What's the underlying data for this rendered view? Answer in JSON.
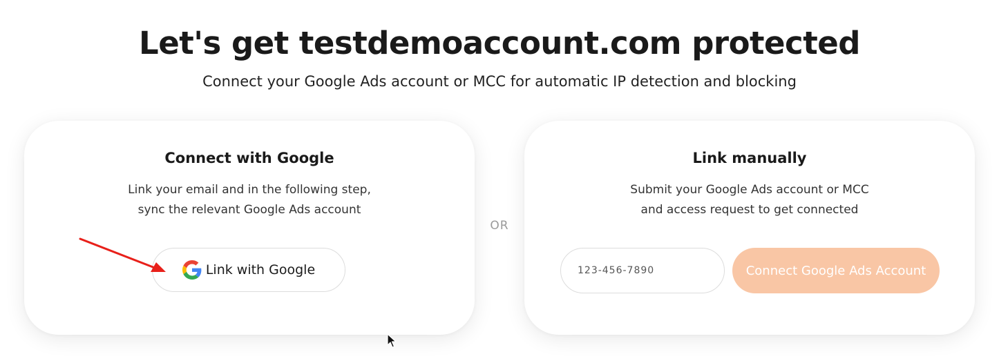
{
  "header": {
    "title": "Let's get testdemoaccount.com protected",
    "subtitle": "Connect your Google Ads account or MCC for automatic IP detection and blocking"
  },
  "google_card": {
    "title": "Connect with Google",
    "desc_line1": "Link your email and in the following step,",
    "desc_line2": "sync the relevant Google Ads account",
    "button_label": "Link with Google",
    "button_icon": "google-g-logo-icon"
  },
  "separator": {
    "label": "OR"
  },
  "manual_card": {
    "title": "Link manually",
    "desc_line1": "Submit your Google Ads account or MCC",
    "desc_line2": "and access request to get connected",
    "input_placeholder": "123-456-7890",
    "input_value": "",
    "button_label": "Connect Google Ads Account"
  },
  "colors": {
    "connect_button_bg": "#f9c6a5",
    "annotation_arrow": "#e8201a",
    "google_blue": "#4285F4",
    "google_red": "#EA4335",
    "google_yellow": "#FBBC05",
    "google_green": "#34A853"
  },
  "overlays": {
    "annotation_arrow_icon": "red-arrow-icon",
    "cursor_icon": "mouse-pointer-icon"
  }
}
